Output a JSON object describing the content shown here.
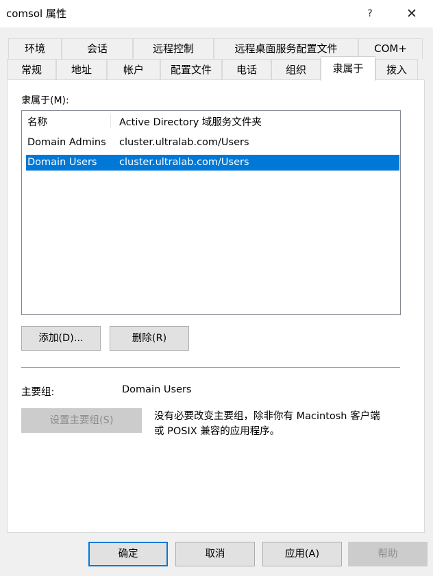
{
  "window": {
    "title": "comsol 属性",
    "help_glyph": "?",
    "close_glyph": "✕"
  },
  "tabs_row1": [
    {
      "label": "环境"
    },
    {
      "label": "会话"
    },
    {
      "label": "远程控制"
    },
    {
      "label": "远程桌面服务配置文件"
    },
    {
      "label": "COM+"
    }
  ],
  "tabs_row2": [
    {
      "label": "常规"
    },
    {
      "label": "地址"
    },
    {
      "label": "帐户"
    },
    {
      "label": "配置文件"
    },
    {
      "label": "电话"
    },
    {
      "label": "组织"
    },
    {
      "label": "隶属于"
    },
    {
      "label": "拨入"
    }
  ],
  "member_of": {
    "label": "隶属于(M):",
    "columns": [
      "名称",
      "Active Directory 域服务文件夹"
    ],
    "rows": [
      {
        "name": "Domain Admins",
        "folder": "cluster.ultralab.com/Users",
        "selected": false
      },
      {
        "name": "Domain Users",
        "folder": "cluster.ultralab.com/Users",
        "selected": true
      }
    ]
  },
  "buttons": {
    "add": "添加(D)...",
    "remove": "删除(R)"
  },
  "primary_group": {
    "label": "主要组:",
    "value": "Domain Users",
    "set_button": "设置主要组(S)",
    "note_line1": "没有必要改变主要组，除非你有 Macintosh 客户端",
    "note_line2": "或 POSIX 兼容的应用程序。"
  },
  "footer": {
    "ok": "确定",
    "cancel": "取消",
    "apply": "应用(A)",
    "help": "帮助"
  },
  "colors": {
    "selection": "#0078d7",
    "dialog_bg": "#f0f0f0",
    "panel_bg": "#ffffff"
  }
}
